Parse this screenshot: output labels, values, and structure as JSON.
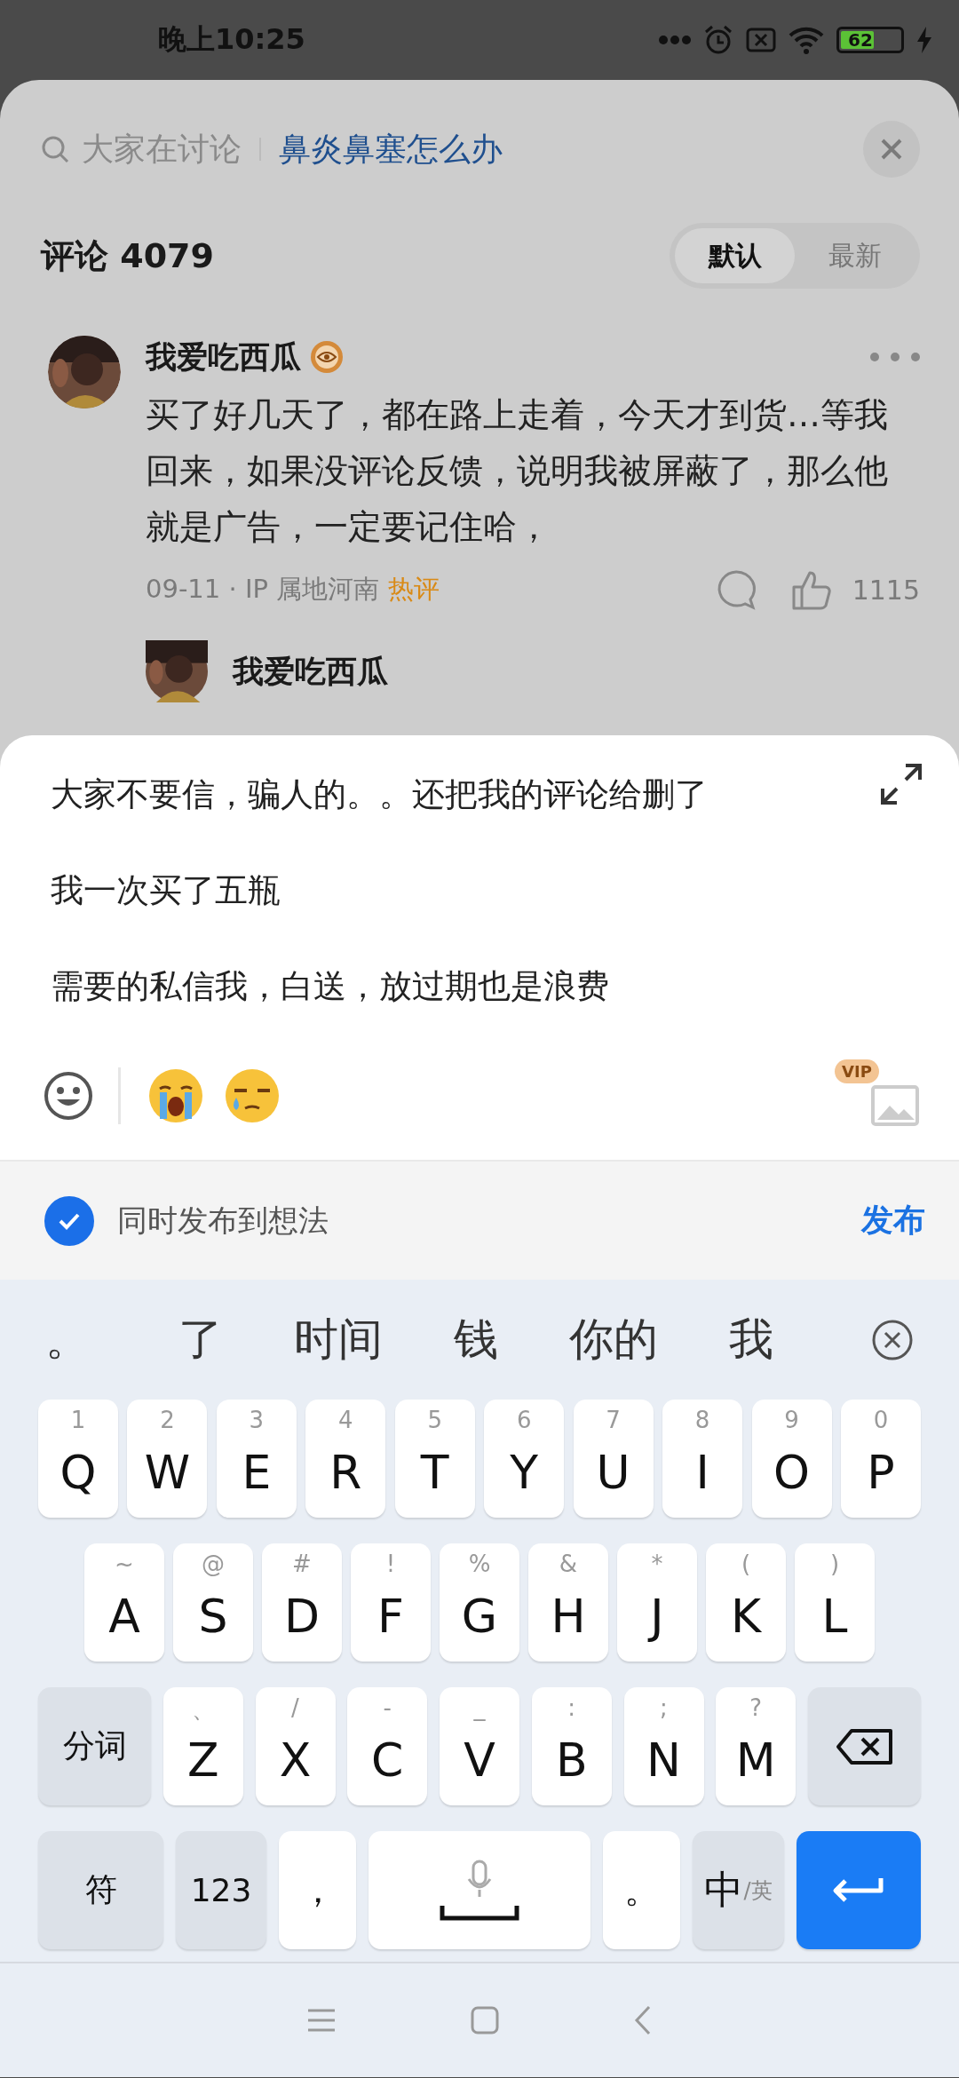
{
  "status_bar": {
    "time": "晚上10:25",
    "battery": "62"
  },
  "search": {
    "placeholder": "大家在讨论",
    "topic": "鼻炎鼻塞怎么办"
  },
  "comments_header": {
    "title": "评论 4079",
    "sort_tabs": [
      {
        "label": "默认",
        "selected": true
      },
      {
        "label": "最新",
        "selected": false
      }
    ]
  },
  "comments": [
    {
      "author": "我爱吃西瓜",
      "text": "买了好几天了，都在路上走着，今天才到货…等我回来，如果没评论反馈，说明我被屏蔽了，那么他就是广告，一定要记住哈，",
      "meta": "09-11 · IP 属地河南",
      "badge": "热评",
      "likes": "1115",
      "replies": [
        {
          "author": "我爱吃西瓜"
        }
      ]
    }
  ],
  "composer": {
    "lines": [
      "大家不要信，骗人的。。还把我的评论给删了",
      "我一次买了五瓶",
      "需要的私信我，白送，放过期也是浪费"
    ],
    "image_badge": "VIP"
  },
  "sync_option": {
    "label": "同时发布到想法",
    "checked": true
  },
  "publish_button": "发布",
  "keyboard": {
    "candidates": [
      "。",
      "了",
      "时间",
      "钱",
      "你的",
      "我"
    ],
    "rows": [
      {
        "keys": [
          {
            "kind": "letter",
            "label": "Q",
            "hint": "1"
          },
          {
            "kind": "letter",
            "label": "W",
            "hint": "2"
          },
          {
            "kind": "letter",
            "label": "E",
            "hint": "3"
          },
          {
            "kind": "letter",
            "label": "R",
            "hint": "4"
          },
          {
            "kind": "letter",
            "label": "T",
            "hint": "5"
          },
          {
            "kind": "letter",
            "label": "Y",
            "hint": "6"
          },
          {
            "kind": "letter",
            "label": "U",
            "hint": "7"
          },
          {
            "kind": "letter",
            "label": "I",
            "hint": "8"
          },
          {
            "kind": "letter",
            "label": "O",
            "hint": "9"
          },
          {
            "kind": "letter",
            "label": "P",
            "hint": "0"
          }
        ]
      },
      {
        "keys": [
          {
            "kind": "letter",
            "label": "A",
            "hint": "~"
          },
          {
            "kind": "letter",
            "label": "S",
            "hint": "@"
          },
          {
            "kind": "letter",
            "label": "D",
            "hint": "#"
          },
          {
            "kind": "letter",
            "label": "F",
            "hint": "!"
          },
          {
            "kind": "letter",
            "label": "G",
            "hint": "%"
          },
          {
            "kind": "letter",
            "label": "H",
            "hint": "&"
          },
          {
            "kind": "letter",
            "label": "J",
            "hint": "*"
          },
          {
            "kind": "letter",
            "label": "K",
            "hint": "("
          },
          {
            "kind": "letter",
            "label": "L",
            "hint": ")"
          }
        ]
      },
      {
        "keys": [
          {
            "kind": "function",
            "label": "分词"
          },
          {
            "kind": "letter",
            "label": "Z",
            "hint": "、"
          },
          {
            "kind": "letter",
            "label": "X",
            "hint": "/"
          },
          {
            "kind": "letter",
            "label": "C",
            "hint": "-"
          },
          {
            "kind": "letter",
            "label": "V",
            "hint": "_"
          },
          {
            "kind": "letter",
            "label": "B",
            "hint": ":"
          },
          {
            "kind": "letter",
            "label": "N",
            "hint": ";"
          },
          {
            "kind": "letter",
            "label": "M",
            "hint": "?"
          },
          {
            "kind": "backspace"
          }
        ]
      },
      {
        "keys": [
          {
            "kind": "function",
            "label": "符"
          },
          {
            "kind": "function",
            "label": "123"
          },
          {
            "kind": "punct",
            "label": "，"
          },
          {
            "kind": "space"
          },
          {
            "kind": "punct",
            "label": "。"
          },
          {
            "kind": "lang",
            "label": "中",
            "sub": "/英"
          },
          {
            "kind": "enter"
          }
        ]
      }
    ]
  }
}
